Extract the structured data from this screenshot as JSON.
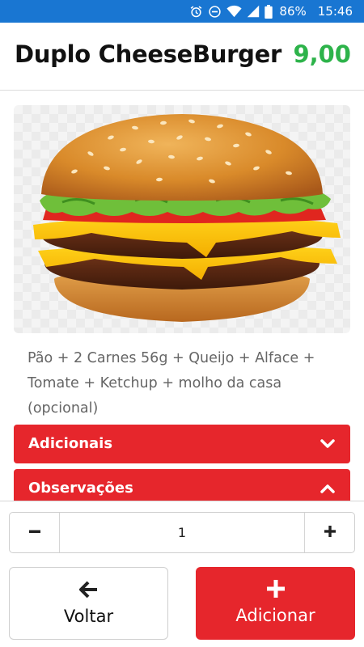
{
  "status_bar": {
    "battery_percent": "86%",
    "time": "15:46",
    "icons": [
      "alarm-icon",
      "do-not-disturb-icon",
      "wifi-icon",
      "signal-icon",
      "battery-icon"
    ]
  },
  "product": {
    "title": "Duplo CheeseBurger",
    "price": "9,00",
    "image_alt": "double cheeseburger",
    "description": "Pão + 2 Carnes 56g + Queijo + Alface + Tomate + Ketchup + molho da casa (opcional)"
  },
  "sections": [
    {
      "label": "Adicionais",
      "icon": "chevron-down-icon"
    },
    {
      "label": "Observações",
      "icon": "chevron-up-icon"
    }
  ],
  "quantity": {
    "value": "1",
    "decrement_icon": "minus-icon",
    "increment_icon": "plus-icon"
  },
  "actions": {
    "back_label": "Voltar",
    "back_icon": "arrow-left-icon",
    "add_label": "Adicionar",
    "add_icon": "plus-icon"
  },
  "colors": {
    "status_bar": "#1976d2",
    "price": "#2db34a",
    "accent_red": "#e6262c"
  }
}
